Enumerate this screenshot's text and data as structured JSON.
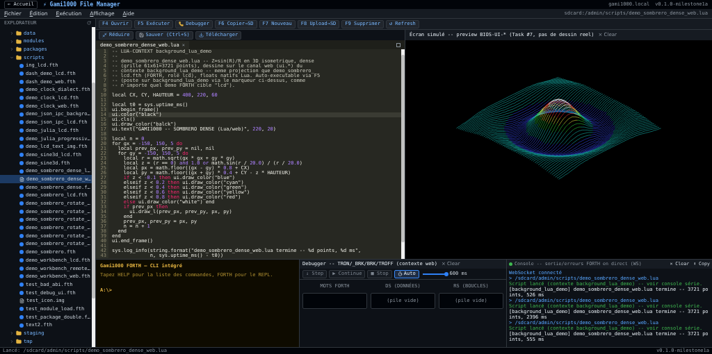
{
  "header": {
    "home_button": "← Accueil",
    "app_title": "⚡ Gami1000 File Manager",
    "host": "gami1000.local",
    "version": "v0.1.0-milestone1a"
  },
  "menu": [
    {
      "label": "Fichier"
    },
    {
      "label": "Édition"
    },
    {
      "label": "Exécution"
    },
    {
      "label": "Affichage"
    },
    {
      "label": "Aide"
    }
  ],
  "current_path": "sdcard:/admin/scripts/demo_sombrero_dense_web.lua",
  "sidebar": {
    "title": "EXPLORATEUR",
    "tree": [
      {
        "name": "data",
        "kind": "folder",
        "expanded": false
      },
      {
        "name": "modules",
        "kind": "folder",
        "expanded": false
      },
      {
        "name": "packages",
        "kind": "folder",
        "expanded": false
      },
      {
        "name": "scripts",
        "kind": "folder",
        "expanded": true,
        "children": [
          {
            "name": "ing_lcd.fth",
            "kind": "script",
            "selected": false
          },
          {
            "name": "dash_demo_lcd.fth",
            "kind": "script",
            "selected": false
          },
          {
            "name": "dash_demo_web.fth",
            "kind": "script",
            "selected": false
          },
          {
            "name": "demo_clock_dialect.fth",
            "kind": "script",
            "selected": false
          },
          {
            "name": "demo_clock_lcd.fth",
            "kind": "script",
            "selected": false
          },
          {
            "name": "demo_clock_web.fth",
            "kind": "script",
            "selected": false
          },
          {
            "name": "demo_json_ipc_backgro…",
            "kind": "script",
            "selected": false
          },
          {
            "name": "demo_json_ipc_lcd.fth",
            "kind": "script",
            "selected": false
          },
          {
            "name": "demo_julia_lcd.fth",
            "kind": "script",
            "selected": false
          },
          {
            "name": "demo_julia_progressiv…",
            "kind": "script",
            "selected": false
          },
          {
            "name": "demo_lcd_text_img.fth",
            "kind": "script",
            "selected": false
          },
          {
            "name": "demo_sine3d_lcd.fth",
            "kind": "script",
            "selected": false
          },
          {
            "name": "demo_sine3d.fth",
            "kind": "script",
            "selected": false
          },
          {
            "name": "demo_sombrero_dense_l…",
            "kind": "script",
            "selected": false
          },
          {
            "name": "demo_sombrero_dense_w…",
            "kind": "document",
            "selected": true
          },
          {
            "name": "demo_sombrero_dense.f…",
            "kind": "script",
            "selected": false
          },
          {
            "name": "demo_sombrero_lcd.fth",
            "kind": "script",
            "selected": false
          },
          {
            "name": "demo_sombrero_rotate_…",
            "kind": "script",
            "selected": false
          },
          {
            "name": "demo_sombrero_rotate_…",
            "kind": "script",
            "selected": false
          },
          {
            "name": "demo_sombrero_rotate_…",
            "kind": "script",
            "selected": false
          },
          {
            "name": "demo_sombrero_rotate_…",
            "kind": "script",
            "selected": false
          },
          {
            "name": "demo_sombrero_rotate_…",
            "kind": "script",
            "selected": false
          },
          {
            "name": "demo_sombrero_rotate_…",
            "kind": "script",
            "selected": false
          },
          {
            "name": "demo_sombrero.fth",
            "kind": "script",
            "selected": false
          },
          {
            "name": "demo_workbench_lcd.fth",
            "kind": "script",
            "selected": false
          },
          {
            "name": "demo_workbench_remote…",
            "kind": "script",
            "selected": false
          },
          {
            "name": "demo_workbench_web.fth",
            "kind": "script",
            "selected": false
          },
          {
            "name": "test_bad_abi.fth",
            "kind": "script",
            "selected": false
          },
          {
            "name": "test_debug_ui.fth",
            "kind": "script",
            "selected": false
          },
          {
            "name": "test_icon.img",
            "kind": "document",
            "selected": false
          },
          {
            "name": "test_module_load.fth",
            "kind": "script",
            "selected": false
          },
          {
            "name": "test_package_double.f…",
            "kind": "script",
            "selected": false
          },
          {
            "name": "text2.fth",
            "kind": "script",
            "selected": false
          }
        ]
      },
      {
        "name": "staging",
        "kind": "folder",
        "expanded": false
      },
      {
        "name": "tmp",
        "kind": "folder",
        "expanded": false
      }
    ]
  },
  "toolbar": [
    {
      "label": "F4 Ouvrir",
      "kind": "text"
    },
    {
      "label": "F5 Exécuter",
      "kind": "text"
    },
    {
      "label": "Debugger",
      "kind": "debug"
    },
    {
      "label": "F6 Copier→SD",
      "kind": "text"
    },
    {
      "label": "F7 Nouveau",
      "kind": "text"
    },
    {
      "label": "F8 Upload→SD",
      "kind": "text"
    },
    {
      "label": "F9 Supprimer",
      "kind": "text"
    },
    {
      "label": "↺ Refresh",
      "kind": "text"
    }
  ],
  "editor_toolbar": [
    {
      "label": "Réduire",
      "kind": "minimize"
    },
    {
      "label": "Sauver (Ctrl+S)",
      "kind": "save"
    },
    {
      "label": "Télécharger",
      "kind": "download"
    }
  ],
  "editor": {
    "tab": {
      "label": "demo_sombrero_dense_web.lua",
      "close": "×",
      "selected": true
    },
    "lines": [
      {
        "number": "1",
        "current": false,
        "text": "-- LUA-CONTEXT background_lua_demo"
      },
      {
        "number": "2",
        "current": false,
        "text": "--"
      },
      {
        "number": "3",
        "current": false,
        "text": "-- demo_sombrero_dense_web.lua -- Z=sin(R)/R en 3D isometrique, dense"
      },
      {
        "number": "4",
        "current": false,
        "text": "-- (grille 61x61=3721 points), dessine sur le canal web (ui.*) du"
      },
      {
        "number": "5",
        "current": false,
        "text": "-- contexte background_lua_demo -- meme projection que demo_sombrero_"
      },
      {
        "number": "6",
        "current": false,
        "text": "-- lcd.fth (FORTH, role lcd), floats natifs Lua. Auto-executable via F5"
      },
      {
        "number": "7",
        "current": false,
        "text": "-- (poste sur background_lua_demo via le marqueur ci-dessus, comme"
      },
      {
        "number": "8",
        "current": false,
        "text": "-- n'importe quel demo FORTH cible \"lcd\")."
      },
      {
        "number": "9",
        "current": false
      },
      {
        "number": "10",
        "current": false,
        "text": "local CX, CY, HAUTEUR = 400, 220, 60"
      },
      {
        "number": "11",
        "current": false
      },
      {
        "number": "12",
        "current": false,
        "text": "local t0 = sys.uptime_ms()"
      },
      {
        "number": "13",
        "current": false,
        "text": "ui.begin_frame()"
      },
      {
        "number": "14",
        "current": true,
        "text": "ui.color(\"black\")"
      },
      {
        "number": "15",
        "current": false,
        "text": "ui.cls()"
      },
      {
        "number": "16",
        "current": false,
        "text": "ui.draw_color(\"balck\")"
      },
      {
        "number": "17",
        "current": false,
        "text": "ui.text(\"GAMI1000 -- SOMBRERO DENSE (Lua/web)\", 220, 20)"
      },
      {
        "number": "18",
        "current": false
      },
      {
        "number": "19",
        "current": false,
        "text": "local n = 0"
      },
      {
        "number": "20",
        "current": false,
        "text": "for gx = -150, 150, 5 do"
      },
      {
        "number": "21",
        "current": false,
        "text": "  local prev_px, prev_py = nil, nil"
      },
      {
        "number": "22",
        "current": false,
        "text": "  for gy = -150, 150, 5 do"
      },
      {
        "number": "23",
        "current": false,
        "text": "    local r = math.sqrt(gx * gx + gy * gy)"
      },
      {
        "number": "24",
        "current": false,
        "text": "    local z = (r == 0) and 1.0 or math.sin(r / 20.0) / (r / 20.0)"
      },
      {
        "number": "25",
        "current": false,
        "text": "    local px = math.floor((gx - gy) * 0.8 + CX)"
      },
      {
        "number": "26",
        "current": false,
        "text": "    local py = math.floor((gx + gy) * 0.4 + CY - z * HAUTEUR)"
      },
      {
        "number": "27",
        "current": false,
        "text": "    if z < -0.1 then ui.draw_color(\"blue\")"
      },
      {
        "number": "28",
        "current": false,
        "text": "    elseif z < 0.2 then ui.draw_color(\"cyan\")"
      },
      {
        "number": "29",
        "current": false,
        "text": "    elseif z < 0.4 then ui.draw_color(\"green\")"
      },
      {
        "number": "30",
        "current": false,
        "text": "    elseif z < 0.6 then ui.draw_color(\"yellow\")"
      },
      {
        "number": "31",
        "current": false,
        "text": "    elseif z < 0.8 then ui.draw_color(\"red\")"
      },
      {
        "number": "32",
        "current": false,
        "text": "    else ui.draw_color(\"white\") end"
      },
      {
        "number": "33",
        "current": false,
        "text": "    if prev_px then"
      },
      {
        "number": "34",
        "current": false,
        "text": "      ui.draw_l(prev_px, prev_py, px, py)"
      },
      {
        "number": "35",
        "current": false,
        "text": "    end"
      },
      {
        "number": "36",
        "current": false,
        "text": "    prev_px, prev_py = px, py"
      },
      {
        "number": "37",
        "current": false,
        "text": "    n = n + 1"
      },
      {
        "number": "38",
        "current": false,
        "text": "  end"
      },
      {
        "number": "39",
        "current": false,
        "text": "end"
      },
      {
        "number": "40",
        "current": false,
        "text": "ui.end_frame()"
      },
      {
        "number": "41",
        "current": false
      },
      {
        "number": "42",
        "current": false,
        "text": "sys.log_info(string.format(\"demo_sombrero_dense_web.lua termine -- %d points, %d ms\","
      },
      {
        "number": "43",
        "current": false,
        "text": "             n, sys.uptime_ms() - t0))"
      }
    ]
  },
  "preview": {
    "title": "Écran simulé -- preview BIOS-UI-* (Task #7, pas de dessin reel)",
    "clear": "× Clear"
  },
  "cli": {
    "title": "Gami1000 FORTH — CLI intégré",
    "hint": "Tapez HELP pour la liste des commandes, FORTH pour le REPL.",
    "prompt": "A:\\>"
  },
  "debugger": {
    "title": "Debugger -- TRON/_BRK/BRK/TROFF (contexte web)",
    "clear": "× Clear",
    "controls": [
      {
        "label": "↓ Step",
        "kind": "text",
        "disabled": true,
        "on": false
      },
      {
        "label": "▶ Continue",
        "kind": "text",
        "disabled": true,
        "on": false
      },
      {
        "label": "■ Stop",
        "kind": "text",
        "disabled": true,
        "on": false
      },
      {
        "label": "Auto",
        "kind": "timer",
        "disabled": false,
        "on": true
      }
    ],
    "speed": {
      "level": 0.95,
      "reading": "600 ms"
    },
    "stacks": [
      {
        "title": "MOTS FORTH"
      },
      {
        "title": "DS (DONNÉES)",
        "content": "(pile vide)"
      },
      {
        "title": "RS (BOUCLES)",
        "content": "(pile vide)"
      }
    ]
  },
  "console": {
    "title": "Console -- sortie/erreurs FORTH en direct (WS)",
    "connected": true,
    "clear": "× Clear",
    "copy": "⬇ Copy",
    "lines": [
      {
        "kind": "info",
        "text": "WebSocket connecté"
      },
      {
        "kind": "command",
        "text": "> /sdcard/admin/scripts/demo_sombrero_dense_web.lua"
      },
      {
        "kind": "ok",
        "text": "Script lancé (contexte background_lua_demo) -- voir console série."
      },
      {
        "kind": "log",
        "text": "[background_lua_demo] demo_sombrero_dense_web.lua termine -- 3721 points, 526 ms"
      },
      {
        "kind": "command",
        "text": "> /sdcard/admin/scripts/demo_sombrero_dense_web.lua"
      },
      {
        "kind": "ok",
        "text": "Script lancé (contexte background_lua_demo) -- voir console série."
      },
      {
        "kind": "log",
        "text": "[background_lua_demo] demo_sombrero_dense_web.lua termine -- 3721 points, 2396 ms"
      },
      {
        "kind": "command",
        "text": "> /sdcard/admin/scripts/demo_sombrero_dense_web.lua"
      },
      {
        "kind": "ok",
        "text": "Script lancé (contexte background_lua_demo) -- voir console série."
      },
      {
        "kind": "log",
        "text": "[background_lua_demo] demo_sombrero_dense_web.lua termine -- 3721 points, 555 ms"
      }
    ]
  },
  "status_bar": {
    "message": "Lancé: /sdcard/admin/scripts/demo_sombrero_dense_web.lua",
    "version": "v0.1.0-milestone1a"
  }
}
